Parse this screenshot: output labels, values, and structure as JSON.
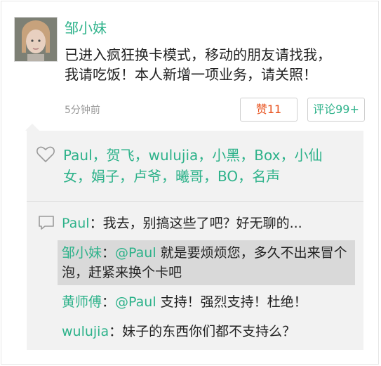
{
  "post": {
    "author": "邹小妹",
    "text_line1": "已进入疯狂换卡模式，移动的朋友请找我，",
    "text_line2": "我请吃饭！本人新增一项业务，请关照！",
    "time": "5分钟前"
  },
  "actions": {
    "like_label": "赞11",
    "comment_label": "评论99+"
  },
  "likes": {
    "line1": "Paul，贺飞，wulujia，小黑，Box，小仙",
    "line2": "女，娟子，卢爷，曦哥，BO，名声"
  },
  "comments": [
    {
      "user": "Paul",
      "colon": "：",
      "mention": "",
      "text": "我去，别搞这些了吧？好无聊的..."
    },
    {
      "user": "邹小妹",
      "colon": "：",
      "mention": "@Paul",
      "text": " 就是要烦烦您，多久不出来冒个泡，赶紧来换个卡吧"
    },
    {
      "user": "黄师傅",
      "colon": "：",
      "mention": "@Paul",
      "text": " 支持！强烈支持！杜绝！"
    },
    {
      "user": "wulujia",
      "colon": "：",
      "mention": "",
      "text": "妹子的东西你们都不支持么？"
    }
  ],
  "colors": {
    "accent": "#2db28a",
    "like": "#e8531f",
    "panel": "#f2f2f2",
    "highlight": "#d9d9d9"
  },
  "icons": [
    "avatar",
    "heart-icon",
    "comment-icon"
  ]
}
